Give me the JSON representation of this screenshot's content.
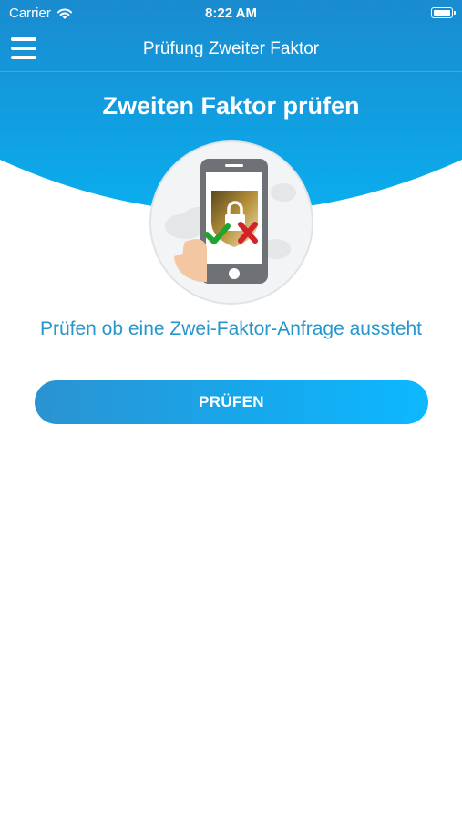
{
  "status_bar": {
    "carrier": "Carrier",
    "time": "8:22 AM"
  },
  "nav": {
    "title": "Prüfung Zweiter Faktor"
  },
  "main": {
    "heading": "Zweiten Faktor prüfen",
    "prompt": "Prüfen ob eine Zwei-Faktor-Anfrage aussteht",
    "button_label": "PRÜFEN"
  },
  "icons": {
    "menu": "hamburger-menu-icon",
    "wifi": "wifi-icon",
    "battery": "battery-icon",
    "illustration": "two-factor-phone-illustration"
  },
  "colors": {
    "header_blue": "#1a8ed2",
    "accent_text": "#2696cc",
    "button_start": "#2b93d1",
    "button_end": "#0db8ff"
  }
}
